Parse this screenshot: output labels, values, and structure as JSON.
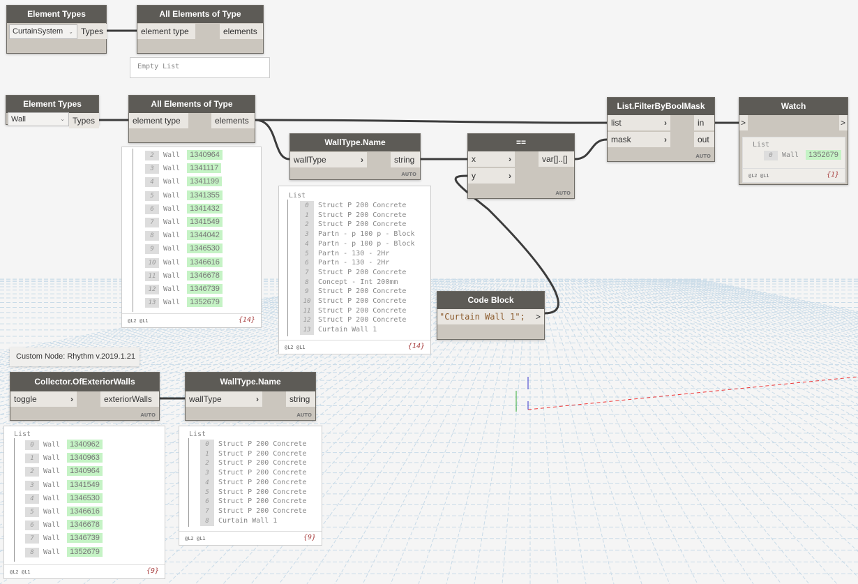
{
  "colors": {
    "node_header": "#5d5b56",
    "node_body": "#cbc6be",
    "port": "#e9e6e1",
    "id_highlight": "#c5f3c5",
    "wire": "#3c3c3c"
  },
  "element_types_1": {
    "title": "Element Types",
    "selected": "CurtainSystem",
    "output": "Types"
  },
  "all_elements_1": {
    "title": "All Elements of Type",
    "input": "element type",
    "output": "elements",
    "preview": "Empty List"
  },
  "element_types_2": {
    "title": "Element Types",
    "selected": "Wall",
    "output": "Types"
  },
  "all_elements_2": {
    "title": "All Elements of Type",
    "input": "element type",
    "output": "elements",
    "preview": {
      "items": [
        [
          "2",
          "Wall",
          "1340964"
        ],
        [
          "3",
          "Wall",
          "1341117"
        ],
        [
          "4",
          "Wall",
          "1341199"
        ],
        [
          "5",
          "Wall",
          "1341355"
        ],
        [
          "6",
          "Wall",
          "1341432"
        ],
        [
          "7",
          "Wall",
          "1341549"
        ],
        [
          "8",
          "Wall",
          "1344042"
        ],
        [
          "9",
          "Wall",
          "1346530"
        ],
        [
          "10",
          "Wall",
          "1346616"
        ],
        [
          "11",
          "Wall",
          "1346678"
        ],
        [
          "12",
          "Wall",
          "1346739"
        ],
        [
          "13",
          "Wall",
          "1352679"
        ]
      ],
      "levels": "@L2 @L1",
      "count": "{14}"
    }
  },
  "walltype_name_1": {
    "title": "WallType.Name",
    "input": "wallType",
    "output": "string",
    "lacing": "AUTO",
    "preview": {
      "header": "List",
      "items": [
        [
          "0",
          "Struct P 200 Concrete"
        ],
        [
          "1",
          "Struct P 200 Concrete"
        ],
        [
          "2",
          "Struct P 200 Concrete"
        ],
        [
          "3",
          "Partn - p 100 p - Block"
        ],
        [
          "4",
          "Partn - p 100 p - Block"
        ],
        [
          "5",
          "Partn - 130 - 2Hr"
        ],
        [
          "6",
          "Partn - 130 - 2Hr"
        ],
        [
          "7",
          "Struct P 200 Concrete"
        ],
        [
          "8",
          "Concept - Int 200mm"
        ],
        [
          "9",
          "Struct P 200 Concrete"
        ],
        [
          "10",
          "Struct P 200 Concrete"
        ],
        [
          "11",
          "Struct P 200 Concrete"
        ],
        [
          "12",
          "Struct P 200 Concrete"
        ],
        [
          "13",
          "Curtain Wall 1"
        ]
      ],
      "levels": "@L2 @L1",
      "count": "{14}"
    }
  },
  "equals": {
    "title": "==",
    "input_x": "x",
    "input_y": "y",
    "output": "var[]..[]",
    "lacing": "AUTO"
  },
  "filter": {
    "title": "List.FilterByBoolMask",
    "input_list": "list",
    "input_mask": "mask",
    "output_in": "in",
    "output_out": "out",
    "lacing": "AUTO"
  },
  "watch": {
    "title": "Watch",
    "input": ">",
    "output": ">",
    "preview": {
      "header": "List",
      "items": [
        [
          "0",
          "Wall",
          "1352679"
        ]
      ],
      "levels": "@L2 @L1",
      "count": "{1}"
    }
  },
  "code_block": {
    "title": "Code Block",
    "code": "\"Curtain Wall 1\";",
    "output": ">"
  },
  "tooltip": "Custom Node: Rhythm v.2019.1.21",
  "collector": {
    "title": "Collector.OfExteriorWalls",
    "input": "toggle",
    "output": "exteriorWalls",
    "lacing": "AUTO",
    "preview": {
      "header": "List",
      "items": [
        [
          "0",
          "Wall",
          "1340962"
        ],
        [
          "1",
          "Wall",
          "1340963"
        ],
        [
          "2",
          "Wall",
          "1340964"
        ],
        [
          "3",
          "Wall",
          "1341549"
        ],
        [
          "4",
          "Wall",
          "1346530"
        ],
        [
          "5",
          "Wall",
          "1346616"
        ],
        [
          "6",
          "Wall",
          "1346678"
        ],
        [
          "7",
          "Wall",
          "1346739"
        ],
        [
          "8",
          "Wall",
          "1352679"
        ]
      ],
      "levels": "@L2 @L1",
      "count": "{9}"
    }
  },
  "walltype_name_2": {
    "title": "WallType.Name",
    "input": "wallType",
    "output": "string",
    "lacing": "AUTO",
    "preview": {
      "header": "List",
      "items": [
        [
          "0",
          "Struct P 200 Concrete"
        ],
        [
          "1",
          "Struct P 200 Concrete"
        ],
        [
          "2",
          "Struct P 200 Concrete"
        ],
        [
          "3",
          "Struct P 200 Concrete"
        ],
        [
          "4",
          "Struct P 200 Concrete"
        ],
        [
          "5",
          "Struct P 200 Concrete"
        ],
        [
          "6",
          "Struct P 200 Concrete"
        ],
        [
          "7",
          "Struct P 200 Concrete"
        ],
        [
          "8",
          "Curtain Wall 1"
        ]
      ],
      "levels": "@L2 @L1",
      "count": "{9}"
    }
  }
}
